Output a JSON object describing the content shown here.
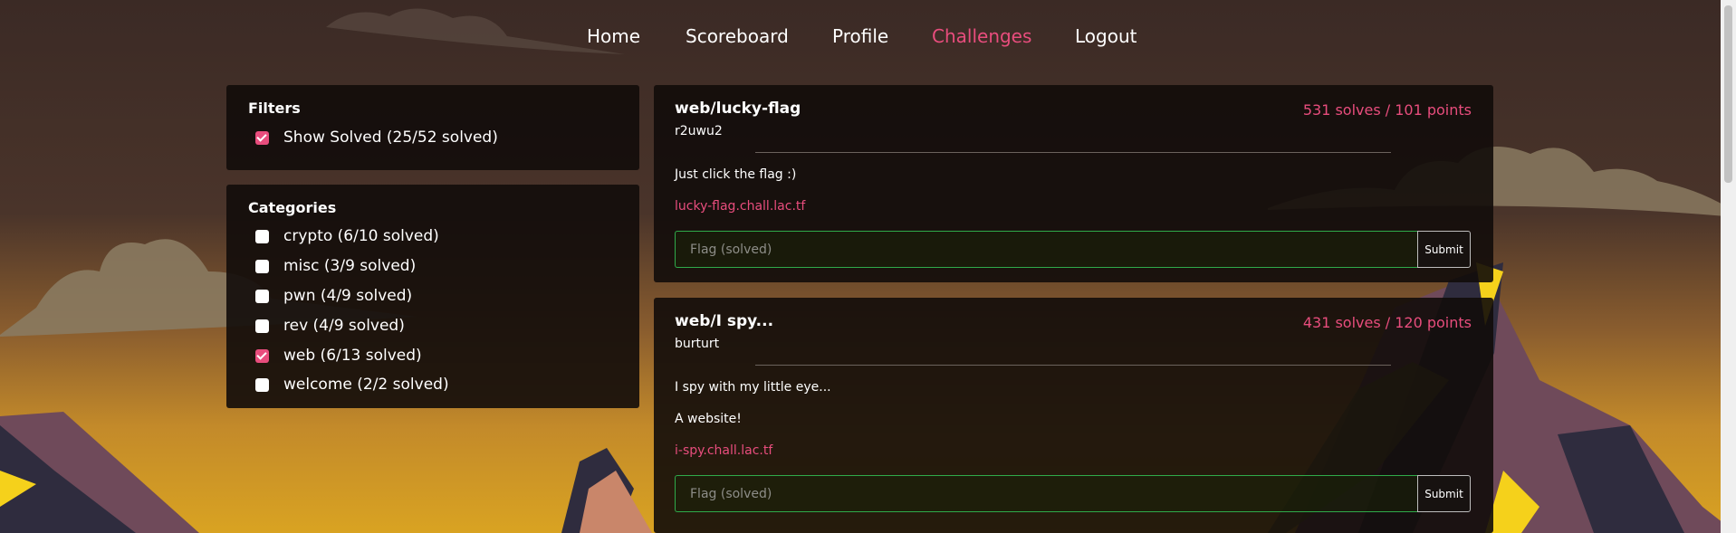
{
  "nav": {
    "items": [
      {
        "label": "Home",
        "active": false
      },
      {
        "label": "Scoreboard",
        "active": false
      },
      {
        "label": "Profile",
        "active": false
      },
      {
        "label": "Challenges",
        "active": true
      },
      {
        "label": "Logout",
        "active": false
      }
    ]
  },
  "filters": {
    "title": "Filters",
    "show_solved": {
      "label": "Show Solved (25/52 solved)",
      "checked": true
    }
  },
  "categories": {
    "title": "Categories",
    "items": [
      {
        "label": "crypto (6/10 solved)",
        "checked": false
      },
      {
        "label": "misc (3/9 solved)",
        "checked": false
      },
      {
        "label": "pwn (4/9 solved)",
        "checked": false
      },
      {
        "label": "rev (4/9 solved)",
        "checked": false
      },
      {
        "label": "web (6/13 solved)",
        "checked": true
      },
      {
        "label": "welcome (2/2 solved)",
        "checked": false
      }
    ]
  },
  "challenges": [
    {
      "title": "web/lucky-flag",
      "author": "r2uwu2",
      "stats": "531 solves / 101 points",
      "description": [
        "Just click the flag :)"
      ],
      "link": "lucky-flag.chall.lac.tf",
      "flag_placeholder": "Flag (solved)",
      "submit_label": "Submit"
    },
    {
      "title": "web/I spy...",
      "author": "burturt",
      "stats": "431 solves / 120 points",
      "description": [
        "I spy with my little eye...",
        "A website!"
      ],
      "link": "i-spy.chall.lac.tf",
      "flag_placeholder": "Flag (solved)",
      "submit_label": "Submit"
    }
  ],
  "colors": {
    "accent": "#e84d7d",
    "solved_border": "#2faa4a"
  }
}
